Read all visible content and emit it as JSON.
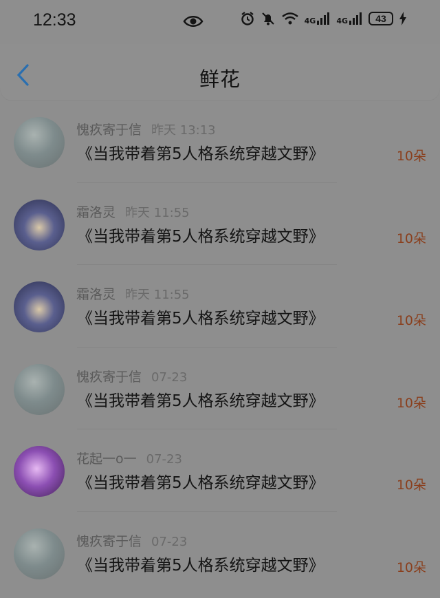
{
  "status_bar": {
    "time": "12:33",
    "network_1": "4G",
    "network_2": "4G",
    "battery": "43",
    "icons": [
      "eye-icon",
      "alarm-icon",
      "mute-icon",
      "wifi-icon",
      "signal-icon",
      "charging-icon"
    ]
  },
  "header": {
    "title": "鲜花",
    "back_icon": "chevron-left-icon",
    "accent_color": "#2a6fb0"
  },
  "items": [
    {
      "user": "愧疚寄于信",
      "date": "昨天 13:13",
      "book": "《当我带着第5人格系统穿越文野》",
      "count": "10朵",
      "avatar": "avatar-1"
    },
    {
      "user": "霜洛灵",
      "date": "昨天 11:55",
      "book": "《当我带着第5人格系统穿越文野》",
      "count": "10朵",
      "avatar": "avatar-2"
    },
    {
      "user": "霜洛灵",
      "date": "昨天 11:55",
      "book": "《当我带着第5人格系统穿越文野》",
      "count": "10朵",
      "avatar": "avatar-2"
    },
    {
      "user": "愧疚寄于信",
      "date": "07-23",
      "book": "《当我带着第5人格系统穿越文野》",
      "count": "10朵",
      "avatar": "avatar-1"
    },
    {
      "user": "花起一o一",
      "date": "07-23",
      "book": "《当我带着第5人格系统穿越文野》",
      "count": "10朵",
      "avatar": "avatar-3"
    },
    {
      "user": "愧疚寄于信",
      "date": "07-23",
      "book": "《当我带着第5人格系统穿越文野》",
      "count": "10朵",
      "avatar": "avatar-1"
    }
  ],
  "colors": {
    "count_color": "#8a3f1d",
    "overlay": "#8e8e8e"
  }
}
